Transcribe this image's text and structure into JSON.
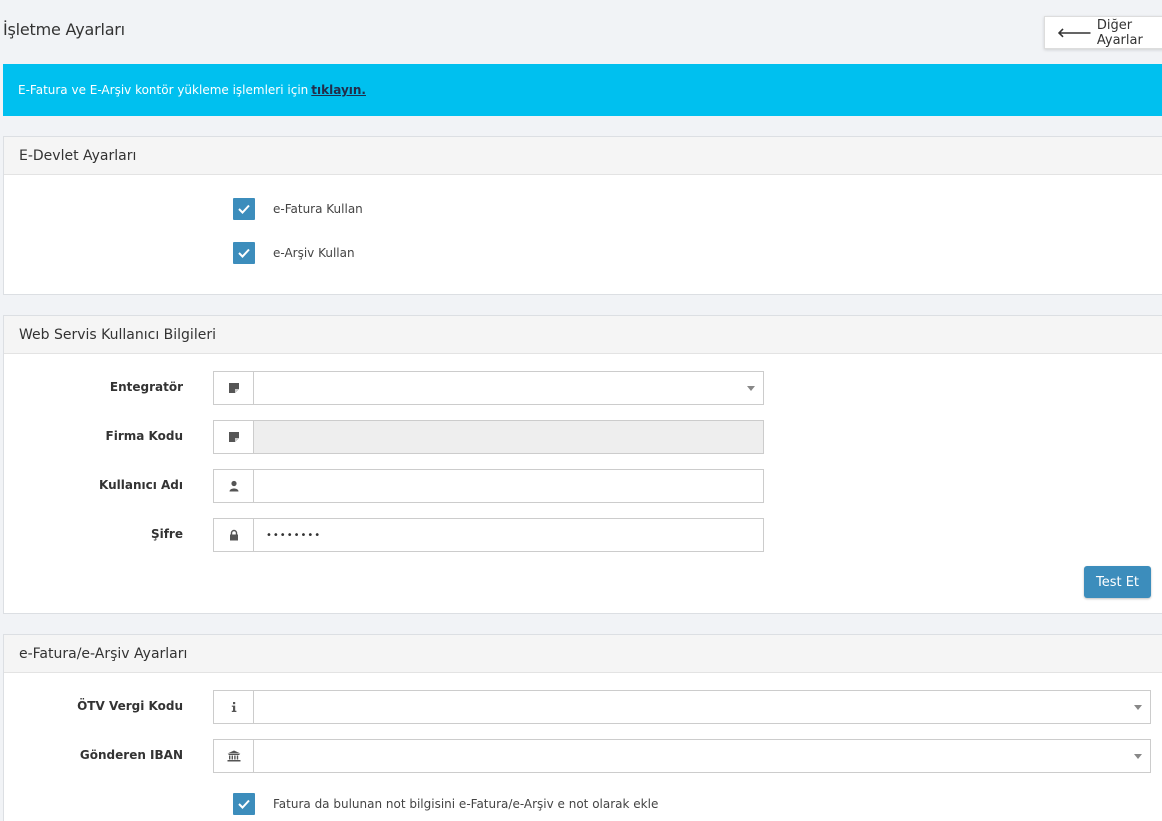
{
  "page": {
    "title": "İşletme Ayarları",
    "other_settings_label": "Diğer Ayarlar"
  },
  "banner": {
    "text": "E-Fatura ve E-Arşiv kontör yükleme işlemleri için",
    "link": "tıklayın."
  },
  "edevlet": {
    "title": "E-Devlet Ayarları",
    "efatura_label": "e-Fatura Kullan",
    "earsiv_label": "e-Arşiv Kullan",
    "efatura_checked": true,
    "earsiv_checked": true
  },
  "webservice": {
    "title": "Web Servis Kullanıcı Bilgileri",
    "integrator_label": "Entegratör",
    "integrator_value": "",
    "company_code_label": "Firma Kodu",
    "company_code_value": "",
    "username_label": "Kullanıcı Adı",
    "username_value": "",
    "password_label": "Şifre",
    "password_value": "••••••••",
    "test_button": "Test Et"
  },
  "einvoice": {
    "title": "e-Fatura/e-Arşiv Ayarları",
    "otv_label": "ÖTV Vergi Kodu",
    "otv_value": "",
    "iban_label": "Gönderen IBAN",
    "iban_value": "",
    "note_checkbox_label": "Fatura da bulunan not bilgisini e-Fatura/e-Arşiv e not olarak ekle",
    "note_checked": true
  },
  "colors": {
    "banner": "#00c0ef",
    "primary": "#3c8dbc",
    "background": "#f1f3f6"
  }
}
